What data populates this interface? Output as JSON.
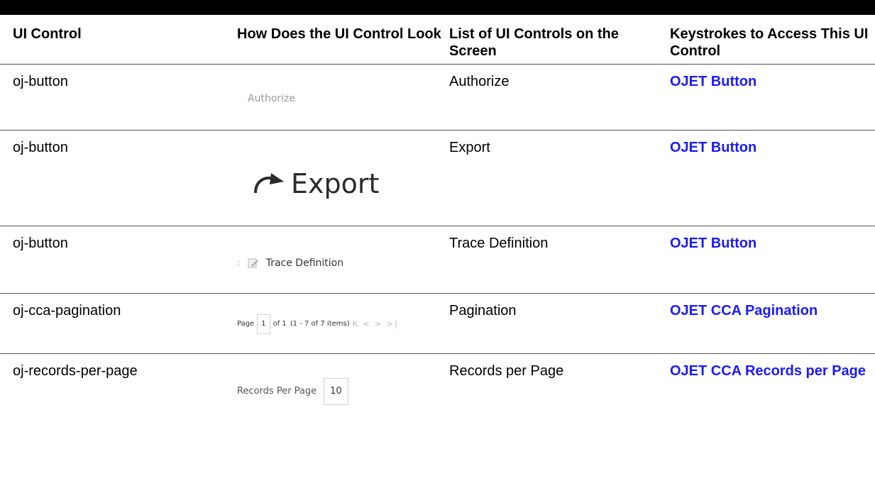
{
  "headers": [
    "UI Control",
    "How Does the UI Control Look",
    "List of UI Controls on the Screen",
    "Keystrokes to Access This UI Control"
  ],
  "rows": [
    {
      "control": "oj-button",
      "look_label": "Authorize",
      "screen_name": "Authorize",
      "keystroke_link": "OJET Button"
    },
    {
      "control": "oj-button",
      "look_label": "Export",
      "look_icon": "redo-arrow-icon",
      "screen_name": "Export",
      "keystroke_link": "OJET Button"
    },
    {
      "control": "oj-button",
      "look_label": "Trace Definition",
      "look_icon": "document-edit-icon",
      "screen_name": "Trace Definition",
      "keystroke_link": "OJET Button"
    },
    {
      "control": "oj-cca-pagination",
      "look_page_label": "Page",
      "look_page_value": "1",
      "look_page_of": "of 1",
      "look_items": "(1 - 7 of  7  items)",
      "look_nav": "K < > >|",
      "screen_name": "Pagination",
      "keystroke_link": "OJET CCA Pagination"
    },
    {
      "control": "oj-records-per-page",
      "look_label": "Records Per Page",
      "look_value": "10",
      "screen_name": "Records per Page",
      "keystroke_link": "OJET CCA Records per Page"
    }
  ],
  "colors": {
    "link": "#1a1aff",
    "rule": "#555555",
    "topbar": "#000000"
  }
}
